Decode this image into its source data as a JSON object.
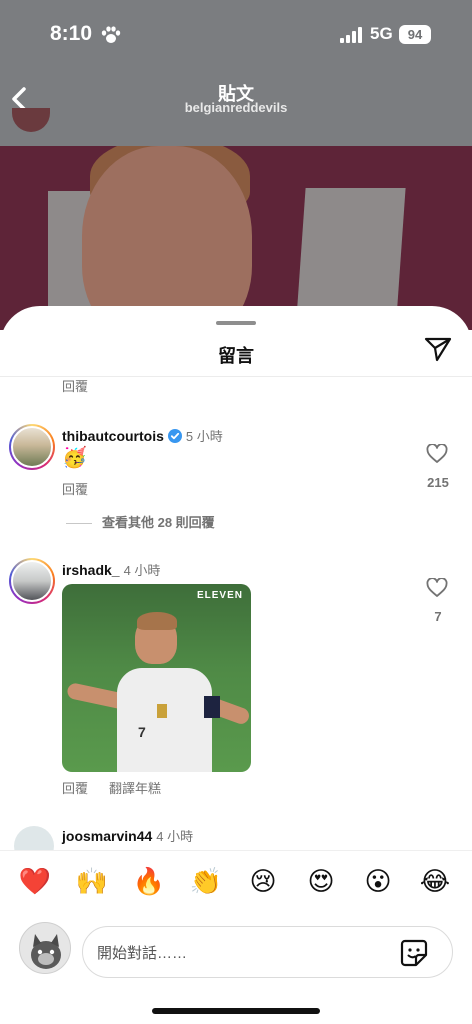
{
  "status_bar": {
    "time": "8:10",
    "network": "5G",
    "battery": "94"
  },
  "post_header": {
    "title": "貼文",
    "username": "belgianreddevils"
  },
  "sheet": {
    "title": "留言"
  },
  "top_reply_label": "回覆",
  "comments": [
    {
      "username": "thibautcourtois",
      "verified": true,
      "time": "5 小時",
      "text": "🥳",
      "reply_label": "回覆",
      "likes": "215",
      "view_more": "查看其他 28 則回覆"
    },
    {
      "username": "irshadk_",
      "time": "4 小時",
      "gif_watermark": "ELEVEN",
      "jersey_number": "7",
      "reply_label": "回覆",
      "translate_label": "翻譯年糕",
      "likes": "7"
    },
    {
      "username": "joosmarvin44",
      "time": "4 小時"
    }
  ],
  "emoji_bar": [
    "❤️",
    "🙌",
    "🔥",
    "👏",
    "😢",
    "😍",
    "😮",
    "😂"
  ],
  "composer": {
    "placeholder": "開始對話……"
  }
}
